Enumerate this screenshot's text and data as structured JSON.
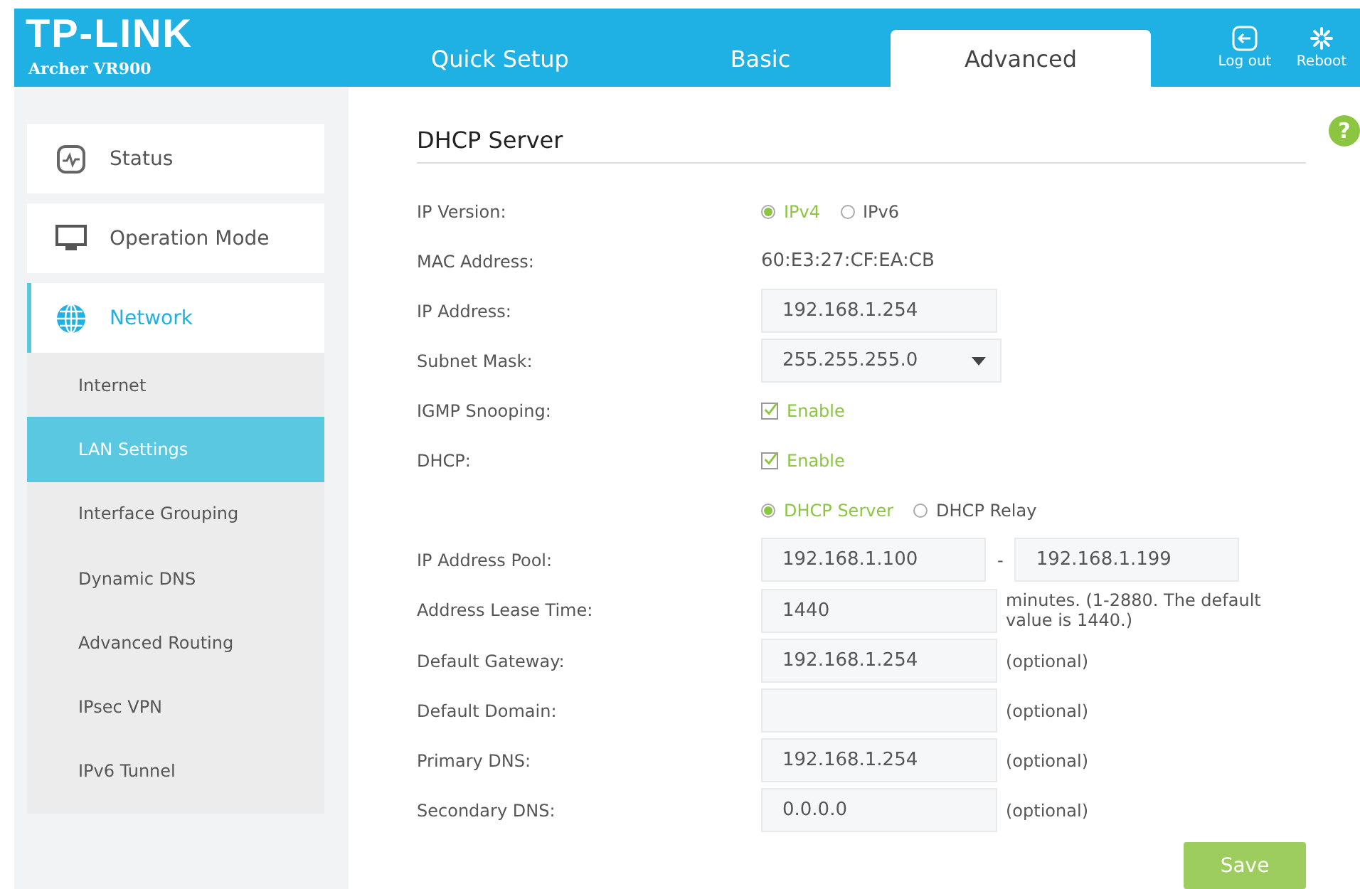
{
  "header": {
    "logo": "TP-LINK",
    "model": "Archer VR900",
    "tabs": [
      {
        "label": "Quick Setup",
        "selected": false
      },
      {
        "label": "Basic",
        "selected": false
      },
      {
        "label": "Advanced",
        "selected": true
      }
    ],
    "actions": [
      {
        "kind": "logout",
        "label": "Log out"
      },
      {
        "kind": "reboot",
        "label": "Reboot"
      }
    ]
  },
  "sidebar": {
    "items": [
      {
        "kind": "status",
        "label": "Status",
        "selected": false
      },
      {
        "kind": "mode",
        "label": "Operation Mode",
        "selected": false
      },
      {
        "kind": "network",
        "label": "Network",
        "selected": true,
        "children": [
          {
            "label": "Internet",
            "selected": false
          },
          {
            "label": "LAN Settings",
            "selected": true
          },
          {
            "label": "Interface Grouping",
            "selected": false
          },
          {
            "label": "Dynamic DNS",
            "selected": false
          },
          {
            "label": "Advanced Routing",
            "selected": false
          },
          {
            "label": "IPsec VPN",
            "selected": false
          },
          {
            "label": "IPv6 Tunnel",
            "selected": false
          }
        ]
      }
    ]
  },
  "form": {
    "title": "DHCP Server",
    "help": "?",
    "rows": [
      {
        "kind": "radio",
        "label": "IP Version:",
        "options": [
          {
            "label": "IPv4",
            "selected": true
          },
          {
            "label": "IPv6",
            "selected": false
          }
        ]
      },
      {
        "kind": "text",
        "label": "MAC Address:",
        "value": "60:E3:27:CF:EA:CB"
      },
      {
        "kind": "input",
        "label": "IP Address:",
        "value": "192.168.1.254"
      },
      {
        "kind": "select",
        "label": "Subnet Mask:",
        "value": "255.255.255.0"
      },
      {
        "kind": "checkbox",
        "label": "IGMP Snooping:",
        "option": "Enable",
        "checked": true
      },
      {
        "kind": "checkbox",
        "label": "DHCP:",
        "option": "Enable",
        "checked": true
      },
      {
        "kind": "radio",
        "options": [
          {
            "label": "DHCP Server",
            "selected": true
          },
          {
            "label": "DHCP Relay",
            "selected": false
          }
        ]
      },
      {
        "kind": "range",
        "label": "IP Address Pool:",
        "from": "192.168.1.100",
        "separator": "-",
        "to": "192.168.1.199"
      },
      {
        "kind": "input",
        "label": "Address Lease Time:",
        "value": "1440",
        "note": "minutes. (1-2880. The default value is 1440.)"
      },
      {
        "kind": "input",
        "label": "Default Gateway:",
        "value": "192.168.1.254",
        "note": "(optional)"
      },
      {
        "kind": "input",
        "label": "Default Domain:",
        "note": "(optional)"
      },
      {
        "kind": "input",
        "label": "Primary DNS:",
        "value": "192.168.1.254",
        "note": "(optional)"
      },
      {
        "kind": "input",
        "label": "Secondary DNS:",
        "value": "0.0.0.0",
        "note": "(optional)"
      }
    ],
    "save": "Save"
  }
}
